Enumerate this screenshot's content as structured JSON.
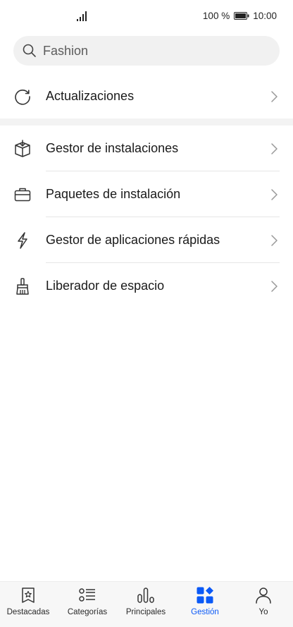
{
  "status_bar": {
    "battery_percent": "100 %",
    "battery_level": 1.0,
    "time": "10:00"
  },
  "search": {
    "placeholder": "Fashion"
  },
  "menu": {
    "items": [
      {
        "label": "Actualizaciones",
        "icon": "refresh-icon"
      },
      {
        "label": "Gestor de instalaciones",
        "icon": "install-box-icon"
      },
      {
        "label": "Paquetes de instalación",
        "icon": "briefcase-icon"
      },
      {
        "label": "Gestor de aplicaciones rápidas",
        "icon": "lightning-icon"
      },
      {
        "label": "Liberador de espacio",
        "icon": "broom-icon"
      }
    ]
  },
  "bottom_nav": {
    "items": [
      {
        "label": "Destacadas",
        "icon": "star-bookmark-icon"
      },
      {
        "label": "Categorías",
        "icon": "categories-list-icon"
      },
      {
        "label": "Principales",
        "icon": "top-chart-icon"
      },
      {
        "label": "Gestión",
        "icon": "manage-grid-icon"
      },
      {
        "label": "Yo",
        "icon": "person-icon"
      }
    ],
    "active_index": 3
  },
  "colors": {
    "accent": "#0a59f7",
    "text": "#1a1a1a",
    "search_bg": "#f1f1f1",
    "nav_bg": "#f7f7f7"
  }
}
